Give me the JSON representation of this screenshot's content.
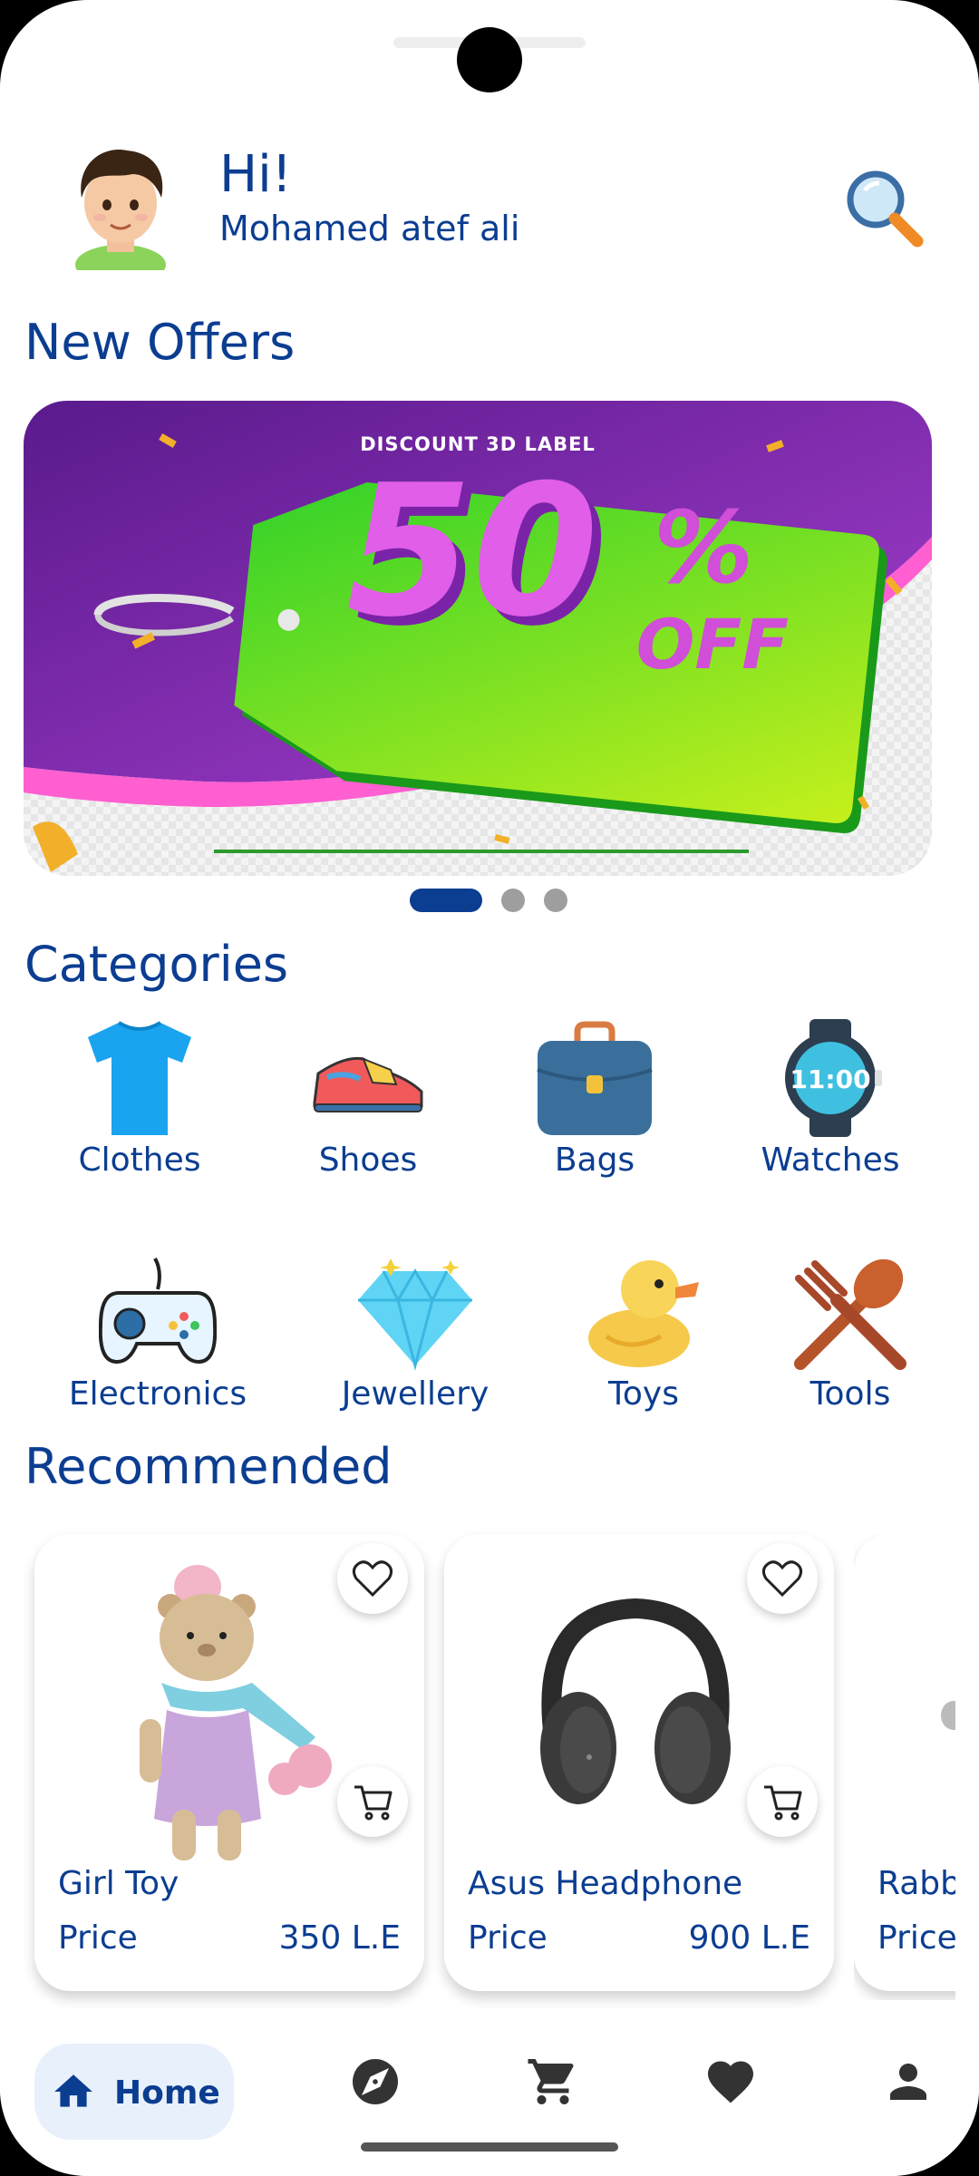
{
  "header": {
    "greeting": "Hi!",
    "user_name": "Mohamed atef ali"
  },
  "sections": {
    "offers_title": "New Offers",
    "categories_title": "Categories",
    "recommended_title": "Recommended"
  },
  "banner": {
    "caption": "DISCOUNT 3D LABEL",
    "big_text": "50%",
    "off_text": "OFF",
    "active_slide": 1,
    "slide_count": 3
  },
  "categories": [
    {
      "label": "Clothes",
      "icon": "tshirt-icon"
    },
    {
      "label": "Shoes",
      "icon": "sneaker-icon"
    },
    {
      "label": "Bags",
      "icon": "briefcase-icon"
    },
    {
      "label": "Watches",
      "icon": "smartwatch-icon"
    },
    {
      "label": "Electronics",
      "icon": "gamepad-icon"
    },
    {
      "label": "Jewellery",
      "icon": "diamond-icon"
    },
    {
      "label": "Toys",
      "icon": "rubber-duck-icon"
    },
    {
      "label": "Tools",
      "icon": "fork-spoon-icon"
    }
  ],
  "products": [
    {
      "name": "Girl Toy",
      "price_label": "Price",
      "price": "350 L.E"
    },
    {
      "name": "Asus Headphone",
      "price_label": "Price",
      "price": "900 L.E"
    },
    {
      "name": "Rabb",
      "price_label": "Price",
      "price": ""
    }
  ],
  "bottom_nav": {
    "home_label": "Home",
    "items": [
      "home-icon",
      "compass-icon",
      "cart-icon",
      "heart-icon",
      "person-icon"
    ]
  },
  "colors": {
    "primary": "#0b3d91",
    "home_pill": "#e8f0fb",
    "dot_active": "#0b3d91",
    "dot_inactive": "#9e9e9e"
  }
}
